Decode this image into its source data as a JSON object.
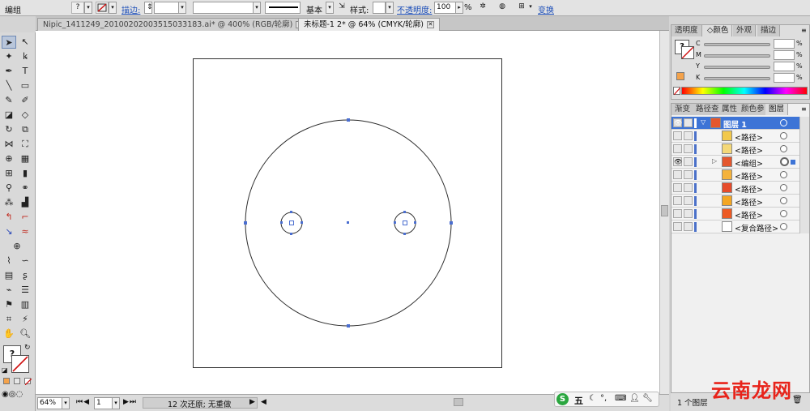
{
  "control_bar": {
    "selection_label": "编组",
    "stroke_label": "描边:",
    "brush_label": "基本",
    "style_label": "样式:",
    "opacity_label": "不透明度:",
    "opacity_value": "100",
    "opacity_unit": "%",
    "transform_label": "变换",
    "fill_glyph": "?"
  },
  "document_tabs": [
    {
      "label": "Nipic_1411249_20100202003515033183.ai* @ 400% (RGB/轮廓)",
      "active": false
    },
    {
      "label": "未标题-1 2* @ 64% (CMYK/轮廓)",
      "active": true
    }
  ],
  "status_bar": {
    "zoom": "64%",
    "artboard": "1",
    "history": "12 次还原; 无重做"
  },
  "color_panel": {
    "tabs": [
      "透明度",
      "颜色",
      "外观",
      "描边"
    ],
    "active_tab": "颜色",
    "channels": [
      "C",
      "M",
      "Y",
      "K"
    ],
    "unit": "%"
  },
  "layers_panel": {
    "tabs": [
      "渐变",
      "路径查",
      "属性",
      "颜色参",
      "图层"
    ],
    "active_tab": "图层",
    "parent_layer": "图层 1",
    "items": [
      {
        "name": "<路径>",
        "color": "#f2c84b",
        "visible": false
      },
      {
        "name": "<路径>",
        "color": "#f4d878",
        "visible": false
      },
      {
        "name": "<编组>",
        "color": "#e4572e",
        "visible": true,
        "expandable": true
      },
      {
        "name": "<路径>",
        "color": "#f4b23c",
        "visible": false
      },
      {
        "name": "<路径>",
        "color": "#e64b2a",
        "visible": false
      },
      {
        "name": "<路径>",
        "color": "#f3a623",
        "visible": false
      },
      {
        "name": "<路径>",
        "color": "#ec5a24",
        "visible": false
      },
      {
        "name": "<复合路径>",
        "color": "#ffffff",
        "visible": false
      }
    ],
    "count_label": "1 个图层"
  },
  "watermark": "云南龙网",
  "ime": {
    "mode": "五"
  },
  "colors": {
    "selection": "#3d74d6",
    "anchor": "#4a6ed0",
    "outline": "#2b2b2b"
  }
}
